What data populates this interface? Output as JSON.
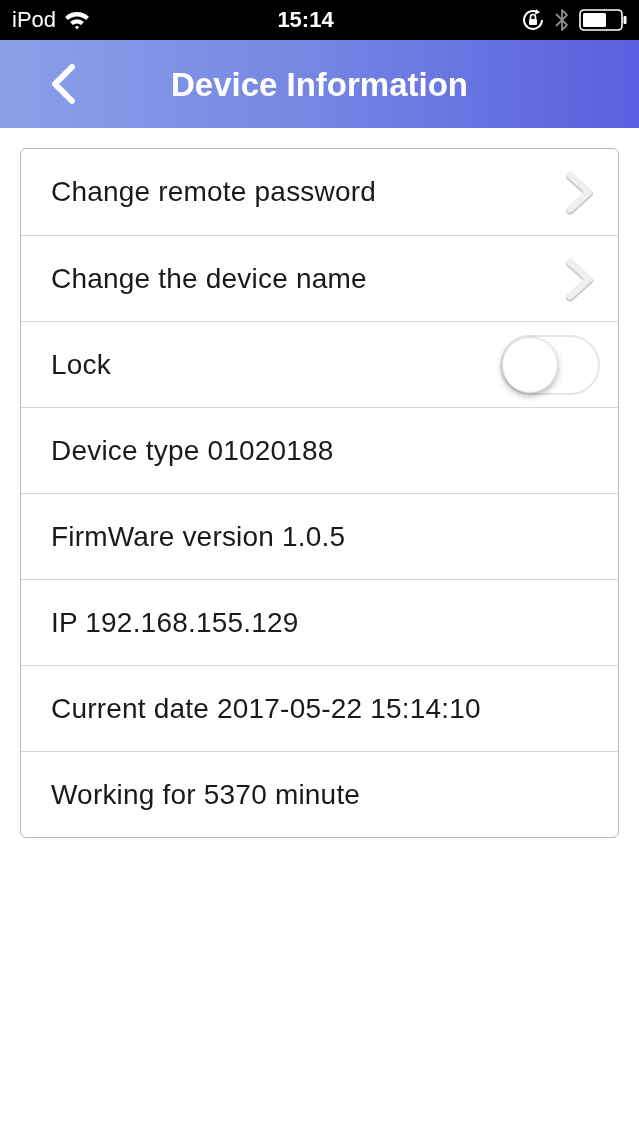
{
  "status_bar": {
    "carrier": "iPod",
    "time": "15:14"
  },
  "nav_bar": {
    "title": "Device Information"
  },
  "rows": [
    {
      "kind": "link",
      "label": "Change remote password"
    },
    {
      "kind": "link",
      "label": "Change the device name"
    },
    {
      "kind": "toggle",
      "label": "Lock",
      "on": false
    },
    {
      "kind": "info",
      "label": "Device type 01020188"
    },
    {
      "kind": "info",
      "label": "FirmWare version 1.0.5"
    },
    {
      "kind": "info",
      "label": "IP 192.168.155.129"
    },
    {
      "kind": "info",
      "label": "Current date 2017-05-22 15:14:10"
    },
    {
      "kind": "info",
      "label": "Working for 5370 minute"
    }
  ]
}
